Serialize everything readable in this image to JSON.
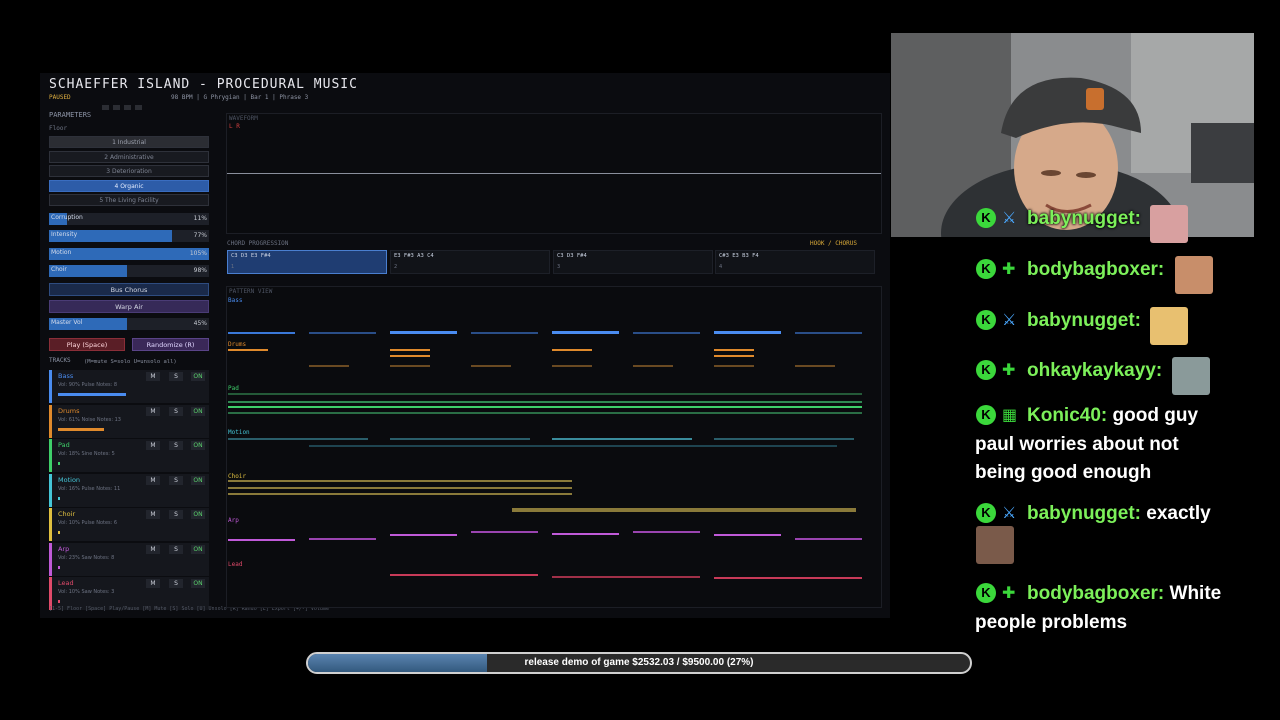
{
  "app": {
    "title": "SCHAEFFER ISLAND - PROCEDURAL MUSIC",
    "status": "PAUSED",
    "meta": "98 BPM | G Phrygian | Bar 1 | Phrase 3",
    "parameters_label": "PARAMETERS",
    "floor_label": "Floor",
    "floors": [
      "1 Industrial",
      "2 Administrative",
      "3 Deterioration",
      "4 Organic",
      "5 The Living Facility"
    ],
    "selected_floor": "4 Organic",
    "sliders": [
      {
        "name": "Corruption",
        "value": "11%",
        "level": 0.11
      },
      {
        "name": "Intensity",
        "value": "77%",
        "level": 0.77
      },
      {
        "name": "Motion",
        "value": "105%",
        "level": 1.0
      },
      {
        "name": "Choir",
        "value": "98%",
        "level": 0.49
      }
    ],
    "bus_chorus": "Bus Chorus",
    "warp_air": "Warp Air",
    "master_vol": {
      "name": "Master Vol",
      "value": "45%",
      "level": 0.49
    },
    "play_button": "Play (Space)",
    "randomize_button": "Randomize (R)",
    "tracks_header": "TRACKS",
    "tracks_hint": "(M=mute S=solo U=unsolo all)",
    "tracks": [
      {
        "name": "Bass",
        "info": "Vol: 90%  Pulse  Notes: 8",
        "color": "#4a8cf0",
        "level": 0.9
      },
      {
        "name": "Drums",
        "info": "Vol: 61%  Noise  Notes: 13",
        "color": "#e08a2c",
        "level": 0.61
      },
      {
        "name": "Pad",
        "info": "Vol: 18%  Sine  Notes: 5",
        "color": "#3fcf6a",
        "level": 0.03
      },
      {
        "name": "Motion",
        "info": "Vol: 16%  Pulse  Notes: 11",
        "color": "#45c6d8",
        "level": 0.03
      },
      {
        "name": "Choir",
        "info": "Vol: 10%  Pulse  Notes: 6",
        "color": "#e0c040",
        "level": 0.03
      },
      {
        "name": "Arp",
        "info": "Vol: 23%  Saw  Notes: 8",
        "color": "#c05ad8",
        "level": 0.03
      },
      {
        "name": "Lead",
        "info": "Vol: 10%  Saw  Notes: 3",
        "color": "#e04a6a",
        "level": 0.03
      }
    ],
    "track_m": "M",
    "track_s": "S",
    "track_on": "ON",
    "footer": "[1-5] Floor  [Space] Play/Pause  [M] Mute  [S] Solo  [U] Unsolo  [R] Rando  [E] Export  [+/-] Volume",
    "waveform_label": "WAVEFORM",
    "waveform_lr": "L R",
    "chord_label": "CHORD PROGRESSION",
    "section_label": "HOOK / CHORUS",
    "chords": [
      {
        "notes": "C3 D3 E3 F#4",
        "index": "1"
      },
      {
        "notes": "E3 F#3 A3 C4",
        "index": "2"
      },
      {
        "notes": "C3 D3 F#4",
        "index": "3"
      },
      {
        "notes": "C#3 E3 B3 F4",
        "index": "4"
      }
    ],
    "pattern_label": "PATTERN VIEW",
    "pattern_tracks": [
      "Bass",
      "Drums",
      "Pad",
      "Motion",
      "Choir",
      "Arp",
      "Lead"
    ]
  },
  "chat": {
    "messages": [
      {
        "user": "babynugget:",
        "badge": "sword",
        "text": ""
      },
      {
        "user": "bodybagboxer:",
        "badge": "plus",
        "text": ""
      },
      {
        "user": "babynugget:",
        "badge": "sword",
        "text": ""
      },
      {
        "user": "ohkaykaykayy:",
        "badge": "plus",
        "text": ""
      },
      {
        "user": "Konic40:",
        "badge": "gift",
        "text": "good guy",
        "line2": "paul worries about not",
        "line3": "being good enough"
      },
      {
        "user": "babynugget:",
        "badge": "sword",
        "text": "exactly"
      },
      {
        "user": "bodybagboxer:",
        "badge": "plus",
        "text": "White",
        "line2": "people problems"
      }
    ],
    "badge_letter": "K"
  },
  "goal": {
    "text": "release demo of game $2532.03 / $9500.00 (27%)",
    "progress": 0.27
  },
  "colors": {
    "accent": "#2e6ab8",
    "chat_user": "#7cf05a",
    "badge": "#3bd83b"
  }
}
